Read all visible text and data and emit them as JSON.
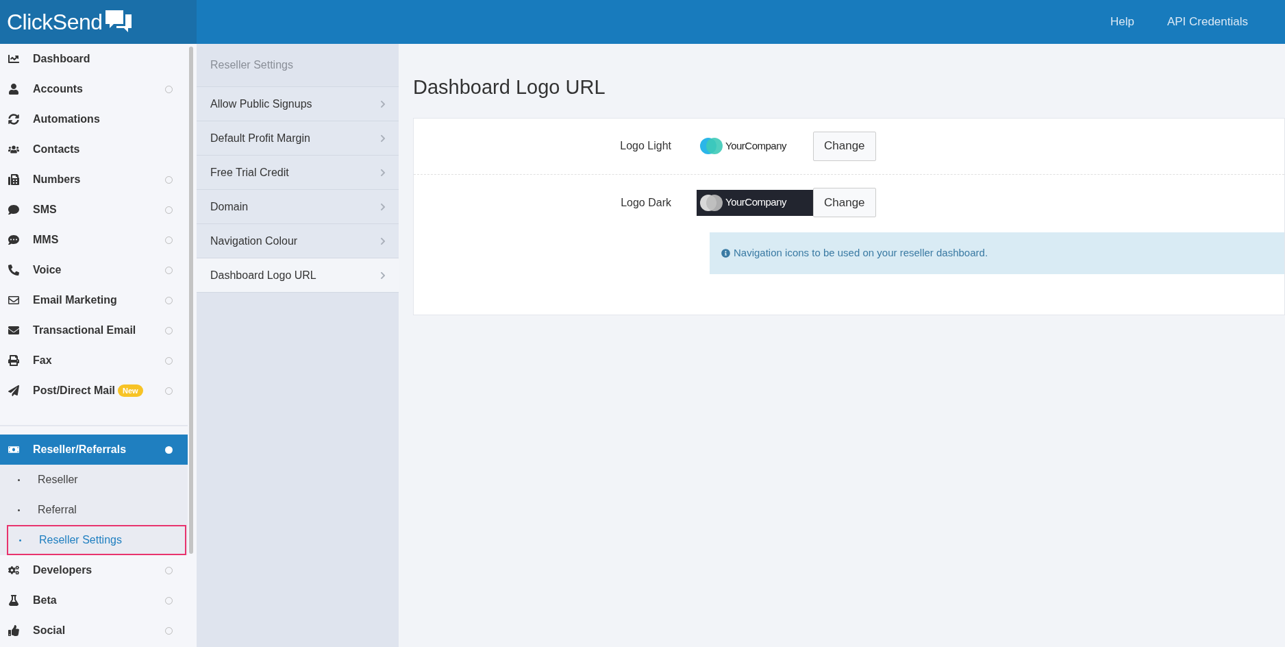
{
  "header": {
    "logo": "Click**Send**",
    "links": [
      "Help",
      "API Credentials"
    ]
  },
  "sidebar": {
    "groups": [
      {
        "items": [
          {
            "label": "Dashboard",
            "indicator": false,
            "selected": false
          },
          {
            "label": "Accounts",
            "indicator": true,
            "selected": false
          },
          {
            "label": "Automations",
            "indicator": false,
            "selected": false
          },
          {
            "label": "Contacts",
            "indicator": false,
            "selected": false
          },
          {
            "label": "Numbers",
            "indicator": true,
            "selected": false
          },
          {
            "label": "SMS",
            "indicator": true,
            "selected": false
          },
          {
            "label": "MMS",
            "indicator": true,
            "selected": false
          },
          {
            "label": "Voice",
            "indicator": true,
            "selected": false
          },
          {
            "label": "Email Marketing",
            "indicator": true,
            "selected": false
          },
          {
            "label": "Transactional Email",
            "indicator": true,
            "selected": false
          },
          {
            "label": "Fax",
            "indicator": true,
            "selected": false
          },
          {
            "label": "Post/Direct Mail",
            "indicator": true,
            "selected": false,
            "badge": "New"
          }
        ]
      },
      {
        "items": [
          {
            "label": "Reseller/Referrals",
            "indicator": true,
            "selected": true,
            "children": [
              {
                "label": "Reseller",
                "selected": false,
                "highlighted": false
              },
              {
                "label": "Referral",
                "selected": false,
                "highlighted": false
              },
              {
                "label": "Reseller Settings",
                "selected": true,
                "highlighted": true
              }
            ]
          },
          {
            "label": "Developers",
            "indicator": true,
            "selected": false
          },
          {
            "label": "Beta",
            "indicator": true,
            "selected": false
          },
          {
            "label": "Social",
            "indicator": true,
            "selected": false
          }
        ]
      }
    ]
  },
  "settings_menu": {
    "title": "Reseller Settings",
    "items": [
      {
        "label": "Allow Public Signups",
        "selected": false
      },
      {
        "label": "Default Profit Margin",
        "selected": false
      },
      {
        "label": "Free Trial Credit",
        "selected": false
      },
      {
        "label": "Domain",
        "selected": false
      },
      {
        "label": "Navigation Colour",
        "selected": false
      },
      {
        "label": "Dashboard Logo URL",
        "selected": true
      }
    ]
  },
  "content": {
    "title": "Dashboard Logo URL",
    "rows": [
      {
        "label": "Logo Light",
        "kind": "light",
        "logo_text": "YourCompany",
        "button": "Change"
      },
      {
        "label": "Logo Dark",
        "kind": "dark",
        "logo_text": "YourCompany",
        "button": "Change"
      }
    ],
    "info": "Navigation icons to be used on your reseller dashboard."
  }
}
